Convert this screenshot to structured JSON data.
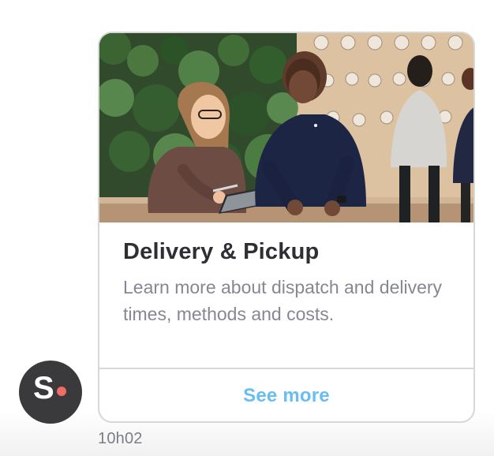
{
  "message": {
    "card": {
      "title": "Delivery & Pickup",
      "description": "Learn more about dispatch and delivery times, methods and costs.",
      "action_label": "See more"
    },
    "timestamp": "10h02",
    "avatar": {
      "letter": "S"
    }
  },
  "icons": {
    "avatar": "brand-s-dot-icon"
  },
  "colors": {
    "card_border": "#d7d7d7",
    "title": "#2e2f35",
    "description": "#858793",
    "action": "#68bdf3",
    "avatar_bg": "#3a3a3d",
    "avatar_dot": "#ef6d63",
    "timestamp": "#7b7d87"
  }
}
